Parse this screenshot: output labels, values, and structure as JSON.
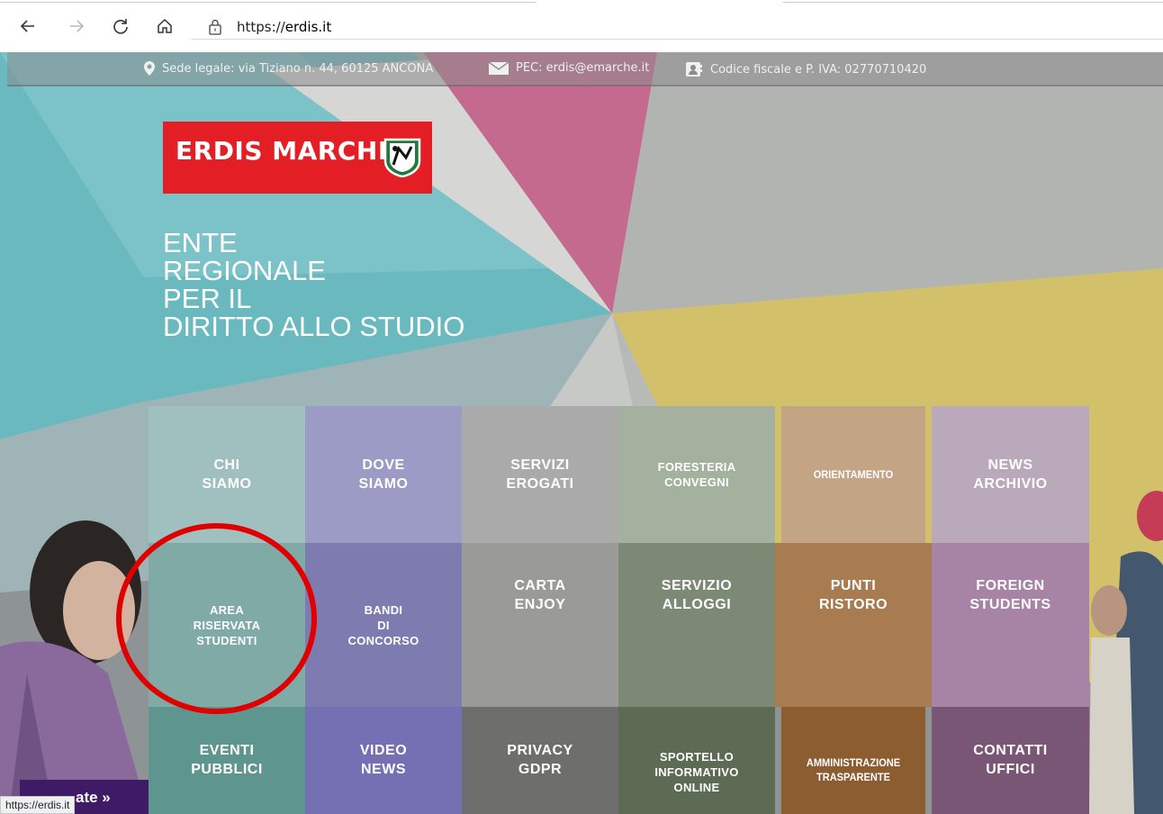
{
  "browser": {
    "url": "https://erdis.it",
    "icons": [
      "back-arrow-icon",
      "forward-arrow-icon",
      "reload-icon",
      "home-icon",
      "lock-icon"
    ]
  },
  "topbar": {
    "address": "Sede legale: via Tiziano n. 44, 60125 ANCONA",
    "pec": "PEC: erdis@emarche.it",
    "fiscal": "Codice fiscale e P. IVA: 02770710420"
  },
  "logo": {
    "text": "ERDIS MARCHE"
  },
  "tagline": [
    "ENTE",
    "REGIONALE",
    "PER IL",
    "DIRITTO ALLO STUDIO"
  ],
  "tiles": [
    {
      "label": "CHI\nSIAMO",
      "color": "#9fc0bf"
    },
    {
      "label": "DOVE\nSIAMO",
      "color": "#9c9bc6"
    },
    {
      "label": "SERVIZI\nEROGATI",
      "color": "#a9aaa9"
    },
    {
      "label": "FORESTERIA\nCONVEGNI",
      "color": "#a5b19f"
    },
    {
      "label": "ORIENTAMENTO",
      "color": "#c3a485"
    },
    {
      "label": "NEWS\nARCHIVIO",
      "color": "#b9a9bb"
    },
    {
      "label": "AREA\nRISERVATA\nSTUDENTI",
      "color": "#7faaa6"
    },
    {
      "label": "BANDI\nDI\nCONCORSO",
      "color": "#7e7bb0"
    },
    {
      "label": "CARTA\nENJOY",
      "color": "#9a9a99"
    },
    {
      "label": "SERVIZIO\nALLOGGI",
      "color": "#7b8975"
    },
    {
      "label": "PUNTI\nRISTORO",
      "color": "#a97b50"
    },
    {
      "label": "FOREIGN\nSTUDENTS",
      "color": "#a783a6"
    },
    {
      "label": "EVENTI\nPUBBLICI",
      "color": "#5f958f"
    },
    {
      "label": "VIDEO\nNEWS",
      "color": "#7470b3"
    },
    {
      "label": "PRIVACY\nGDPR",
      "color": "#6e6e6d"
    },
    {
      "label": "SPORTELLO\nINFORMATIVO\nONLINE",
      "color": "#5d6b55"
    },
    {
      "label": "AMMINISTRAZIONE\nTRASPARENTE",
      "color": "#8c5d31"
    },
    {
      "label": "CONTATTI\nUFFICI",
      "color": "#7a5676"
    }
  ],
  "translate": {
    "label": "ate »"
  },
  "status": {
    "url": "https://erdis.it"
  }
}
